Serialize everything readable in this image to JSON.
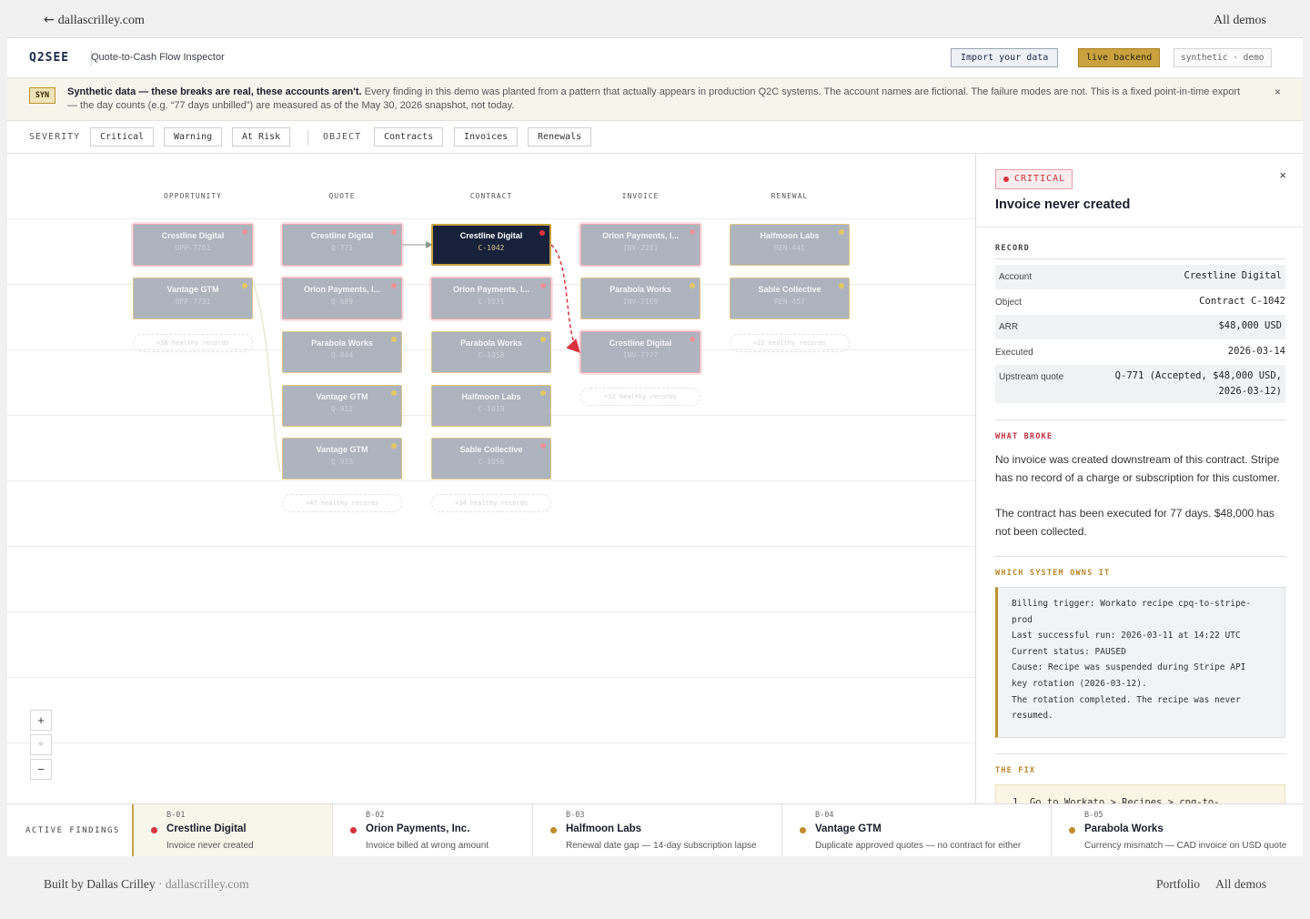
{
  "site": {
    "back_arrow": "←",
    "back_label": "dallascrilley.com",
    "all_demos": "All demos"
  },
  "app": {
    "brand": "Q2SEE",
    "subtitle": "Quote-to-Cash Flow Inspector",
    "import_label": "Import your data",
    "live_label": "live backend",
    "synthetic_label": "synthetic · demo"
  },
  "banner": {
    "badge": "SYN",
    "headline": "Synthetic data — these breaks are real, these accounts aren't.",
    "body": "Every finding in this demo was planted from a pattern that actually appears in production Q2C systems. The account names are fictional. The failure modes are not. This is a fixed point-in-time export — the day counts (e.g. “77 days unbilled”) are measured as of the May 30, 2026 snapshot, not today.",
    "close": "×"
  },
  "filters": {
    "severity_label": "SEVERITY",
    "severity": [
      "Critical",
      "Warning",
      "At Risk"
    ],
    "object_label": "OBJECT",
    "object": [
      "Contracts",
      "Invoices",
      "Renewals"
    ]
  },
  "columns": [
    "OPPORTUNITY",
    "QUOTE",
    "CONTRACT",
    "INVOICE",
    "RENEWAL"
  ],
  "nodes": {
    "opp": [
      {
        "name": "Crestline Digital",
        "id": "OPP-7701"
      },
      {
        "name": "Vantage GTM",
        "id": "OPP-7731"
      }
    ],
    "quote": [
      {
        "name": "Crestline Digital",
        "id": "Q-771"
      },
      {
        "name": "Orion Payments, I...",
        "id": "Q-689"
      },
      {
        "name": "Parabola Works",
        "id": "Q-844"
      },
      {
        "name": "Vantage GTM",
        "id": "Q-912"
      },
      {
        "name": "Vantage GTM",
        "id": "Q-913"
      }
    ],
    "contract": [
      {
        "name": "Crestline Digital",
        "id": "C-1042"
      },
      {
        "name": "Orion Payments, I...",
        "id": "C-1031"
      },
      {
        "name": "Parabola Works",
        "id": "C-1058"
      },
      {
        "name": "Halfmoon Labs",
        "id": "C-1019"
      },
      {
        "name": "Sable Collective",
        "id": "C-1056"
      }
    ],
    "invoice": [
      {
        "name": "Orion Payments, I...",
        "id": "INV-2201"
      },
      {
        "name": "Parabola Works",
        "id": "INV-2169"
      },
      {
        "name": "Crestline Digital",
        "id": "INV-????"
      }
    ],
    "renewal": [
      {
        "name": "Halfmoon Labs",
        "id": "REN-441"
      },
      {
        "name": "Sable Collective",
        "id": "REN-457"
      }
    ]
  },
  "healthy": {
    "opp": "+38 healthy records",
    "quote": "+47 healthy records",
    "contract": "+34 healthy records",
    "invoice": "+32 healthy records",
    "renewal": "+22 healthy records"
  },
  "zoom": {
    "in": "+",
    "fit": "⌖",
    "out": "−"
  },
  "panel": {
    "severity": "CRITICAL",
    "close": "×",
    "title": "Invoice never created",
    "record_label": "RECORD",
    "record": [
      {
        "k": "Account",
        "v": "Crestline Digital"
      },
      {
        "k": "Object",
        "v": "Contract C-1042"
      },
      {
        "k": "ARR",
        "v": "$48,000 USD"
      },
      {
        "k": "Executed",
        "v": "2026-03-14"
      },
      {
        "k": "Upstream quote",
        "v": "Q-771 (Accepted, $48,000 USD, 2026-03-12)"
      }
    ],
    "broke_label": "WHAT BROKE",
    "broke_p1": "No invoice was created downstream of this contract. Stripe has no record of a charge or subscription for this customer.",
    "broke_p2": "The contract has been executed for 77 days. $48,000 has not been collected.",
    "owner_label": "WHICH SYSTEM OWNS IT",
    "owner_lines": [
      "Billing trigger: Workato recipe cpq-to-stripe-",
      "prod",
      "Last successful run: 2026-03-11 at 14:22 UTC",
      "Current status: PAUSED",
      "Cause: Recipe was suspended during Stripe API",
      "key rotation (2026-03-12).",
      "The rotation completed. The recipe was never",
      "resumed."
    ],
    "fix_label": "THE FIX",
    "fix_first": "1. Go to Workato > Recipes > cpq-to-"
  },
  "findings": {
    "label": "ACTIVE FINDINGS",
    "items": [
      {
        "id": "B-01",
        "name": "Crestline Digital",
        "desc": "Invoice never created",
        "severity": "critical"
      },
      {
        "id": "B-02",
        "name": "Orion Payments, Inc.",
        "desc": "Invoice billed at wrong amount",
        "severity": "critical"
      },
      {
        "id": "B-03",
        "name": "Halfmoon Labs",
        "desc": "Renewal date gap — 14-day subscription lapse",
        "severity": "warning"
      },
      {
        "id": "B-04",
        "name": "Vantage GTM",
        "desc": "Duplicate approved quotes — no contract for either",
        "severity": "warning"
      },
      {
        "id": "B-05",
        "name": "Parabola Works",
        "desc": "Currency mismatch — CAD invoice on USD quote",
        "severity": "warning"
      }
    ]
  },
  "footer": {
    "built_by": "Built by Dallas Crilley",
    "sep": " · ",
    "site": "dallascrilley.com",
    "portfolio": "Portfolio",
    "all_demos": "All demos"
  },
  "colors": {
    "accent_gold": "#c9a23f",
    "critical_red": "#d9323f",
    "warning_amber": "#c08a2a",
    "selected_node": "#17223a"
  }
}
